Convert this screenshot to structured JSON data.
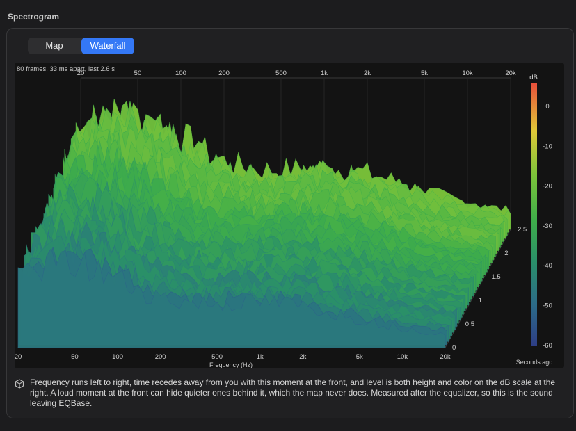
{
  "header": {
    "title": "Spectrogram"
  },
  "tabs": [
    {
      "label": "Map",
      "selected": false
    },
    {
      "label": "Waterfall",
      "selected": true
    }
  ],
  "waterfall": {
    "info": "80 frames, 33 ms apart, last 2.6 s",
    "freq_ticks": [
      "20",
      "50",
      "100",
      "200",
      "500",
      "1k",
      "2k",
      "5k",
      "10k",
      "20k"
    ],
    "freq_label": "Frequency (Hz)",
    "time_ticks": [
      "0",
      "0.5",
      "1",
      "1.5",
      "2",
      "2.5"
    ],
    "time_label": "Seconds ago",
    "colorbar": {
      "title": "dB",
      "ticks": [
        "0",
        "-10",
        "-20",
        "-30",
        "-40",
        "-50",
        "-60"
      ],
      "stops": [
        "#e8503a",
        "#e0c838",
        "#7cc43a",
        "#3fae4a",
        "#2a8f6a",
        "#2c6c88",
        "#2e3e86"
      ]
    }
  },
  "caption": "Frequency runs left to right, time recedes away from you with this moment at the front, and level is both height and color on the dB scale at the right. A loud moment at the front can hide quieter ones behind it, which the map never does. Measured after the equalizer, so this is the sound leaving EQBase.",
  "icons": {
    "caption_icon": "cube-icon"
  }
}
